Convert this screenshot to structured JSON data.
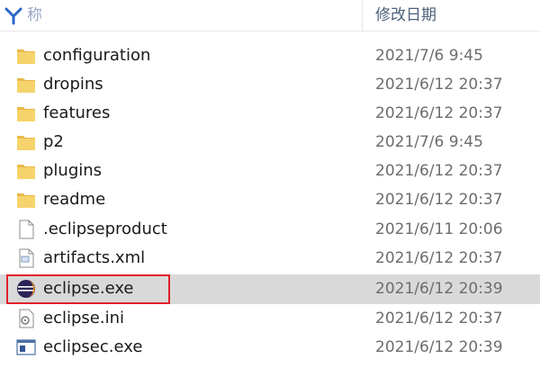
{
  "header": {
    "name_label": "称",
    "date_label": "修改日期"
  },
  "colors": {
    "selected_row": "#d9d9d9",
    "highlight_border": "#e0202a",
    "folder_fill": "#f6d36b",
    "folder_tab": "#e9b949"
  },
  "files": [
    {
      "name": "configuration",
      "date": "2021/7/6 9:45",
      "icon": "folder-icon"
    },
    {
      "name": "dropins",
      "date": "2021/6/12 20:37",
      "icon": "folder-icon"
    },
    {
      "name": "features",
      "date": "2021/6/12 20:37",
      "icon": "folder-icon"
    },
    {
      "name": "p2",
      "date": "2021/7/6 9:45",
      "icon": "folder-icon"
    },
    {
      "name": "plugins",
      "date": "2021/6/12 20:37",
      "icon": "folder-icon"
    },
    {
      "name": "readme",
      "date": "2021/6/12 20:37",
      "icon": "folder-icon"
    },
    {
      "name": ".eclipseproduct",
      "date": "2021/6/11 20:06",
      "icon": "file-icon"
    },
    {
      "name": "artifacts.xml",
      "date": "2021/6/12 20:37",
      "icon": "xml-file-icon"
    },
    {
      "name": "eclipse.exe",
      "date": "2021/6/12 20:39",
      "icon": "eclipse-icon",
      "selected": true
    },
    {
      "name": "eclipse.ini",
      "date": "2021/6/12 20:37",
      "icon": "settings-file-icon"
    },
    {
      "name": "eclipsec.exe",
      "date": "2021/6/12 20:39",
      "icon": "console-app-icon"
    }
  ]
}
